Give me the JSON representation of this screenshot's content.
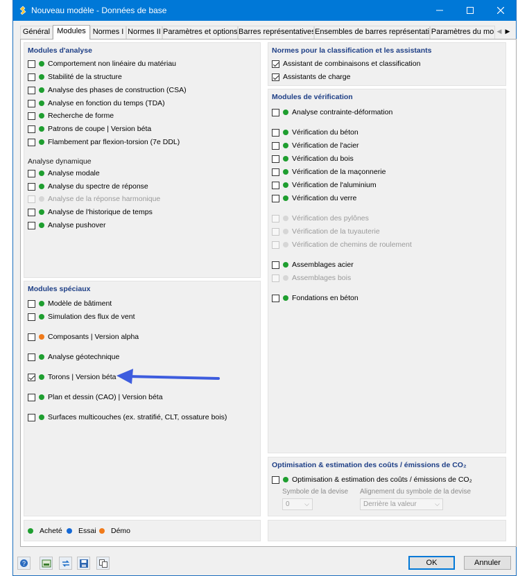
{
  "window": {
    "title": "Nouveau modèle - Données de base"
  },
  "tabs": [
    "Général",
    "Modules",
    "Normes I",
    "Normes II",
    "Paramètres et options",
    "Barres représentatives",
    "Ensembles de barres représentatifs",
    "Paramètres du mo"
  ],
  "colors": {
    "purchased": "#1e9e2f",
    "trial": "#1569d6",
    "demo": "#f07a1a",
    "disabled": "#d6d6d6",
    "accent": "#0078d7",
    "arrow": "#3d5cde"
  },
  "analysis": {
    "title": "Modules d'analyse",
    "items": [
      {
        "label": "Comportement non linéaire du matériau",
        "checked": false,
        "status": "purchased"
      },
      {
        "label": "Stabilité de la structure",
        "checked": false,
        "status": "purchased"
      },
      {
        "label": "Analyse des phases de construction (CSA)",
        "checked": false,
        "status": "purchased"
      },
      {
        "label": "Analyse en fonction du temps (TDA)",
        "checked": false,
        "status": "purchased"
      },
      {
        "label": "Recherche de forme",
        "checked": false,
        "status": "purchased"
      },
      {
        "label": "Patrons de coupe | Version béta",
        "checked": false,
        "status": "purchased"
      },
      {
        "label": "Flambement par flexion-torsion (7e DDL)",
        "checked": false,
        "status": "purchased"
      }
    ],
    "dynamic_title": "Analyse dynamique",
    "dynamic": [
      {
        "label": "Analyse modale",
        "checked": false,
        "status": "purchased"
      },
      {
        "label": "Analyse du spectre de réponse",
        "checked": false,
        "status": "purchased"
      },
      {
        "label": "Analyse de la réponse harmonique",
        "checked": false,
        "status": "disabled"
      },
      {
        "label": "Analyse de l'historique de temps",
        "checked": false,
        "status": "purchased"
      },
      {
        "label": "Analyse pushover",
        "checked": false,
        "status": "purchased"
      }
    ]
  },
  "special": {
    "title": "Modules spéciaux",
    "items": [
      {
        "label": "Modèle de bâtiment",
        "checked": false,
        "status": "purchased"
      },
      {
        "label": "Simulation des flux de vent",
        "checked": false,
        "status": "purchased"
      },
      {
        "label": "Composants | Version alpha",
        "checked": false,
        "status": "demo"
      },
      {
        "label": "Analyse géotechnique",
        "checked": false,
        "status": "purchased"
      },
      {
        "label": "Torons | Version béta",
        "checked": true,
        "status": "purchased"
      },
      {
        "label": "Plan et dessin (CAO) | Version béta",
        "checked": false,
        "status": "purchased"
      },
      {
        "label": "Surfaces multicouches (ex. stratifié, CLT, ossature bois)",
        "checked": false,
        "status": "purchased"
      }
    ]
  },
  "standards": {
    "title": "Normes pour la classification et les assistants",
    "items": [
      {
        "label": "Assistant de combinaisons et classification",
        "checked": true
      },
      {
        "label": "Assistants de charge",
        "checked": true
      }
    ]
  },
  "design": {
    "title": "Modules de vérification",
    "items": [
      {
        "label": "Analyse contrainte-déformation",
        "checked": false,
        "status": "purchased"
      },
      {
        "label": "Vérification du béton",
        "checked": false,
        "status": "purchased"
      },
      {
        "label": "Vérification de l'acier",
        "checked": false,
        "status": "purchased"
      },
      {
        "label": "Vérification du bois",
        "checked": false,
        "status": "purchased"
      },
      {
        "label": "Vérification de la maçonnerie",
        "checked": false,
        "status": "purchased"
      },
      {
        "label": "Vérification de l'aluminium",
        "checked": false,
        "status": "purchased"
      },
      {
        "label": "Vérification du verre",
        "checked": false,
        "status": "purchased"
      },
      {
        "label": "Vérification des pylônes",
        "checked": false,
        "status": "disabled"
      },
      {
        "label": "Vérification de la tuyauterie",
        "checked": false,
        "status": "disabled"
      },
      {
        "label": "Vérification de chemins de roulement",
        "checked": false,
        "status": "disabled"
      },
      {
        "label": "Assemblages acier",
        "checked": false,
        "status": "purchased"
      },
      {
        "label": "Assemblages bois",
        "checked": false,
        "status": "disabled"
      },
      {
        "label": "Fondations en béton",
        "checked": false,
        "status": "purchased"
      }
    ]
  },
  "optimization": {
    "title": "Optimisation & estimation des coûts / émissions de CO₂",
    "item": {
      "label": "Optimisation & estimation des coûts / émissions de CO₂",
      "checked": false,
      "status": "purchased"
    },
    "currency_label": "Symbole de la devise",
    "currency_value": "0",
    "alignment_label": "Alignement du symbole de la devise",
    "alignment_value": "Derrière la valeur"
  },
  "legend": [
    {
      "label": "Acheté",
      "status": "purchased"
    },
    {
      "label": "Essai",
      "status": "trial"
    },
    {
      "label": "Démo",
      "status": "demo"
    }
  ],
  "buttons": {
    "ok": "OK",
    "cancel": "Annuler"
  },
  "footer_icons": [
    "help-icon",
    "units-icon",
    "arrows-icon",
    "save-icon",
    "copy-icon"
  ]
}
